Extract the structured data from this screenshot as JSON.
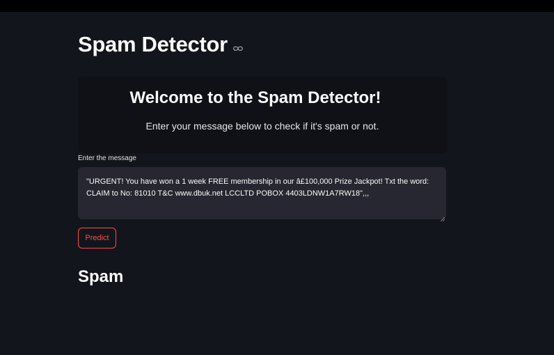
{
  "app": {
    "title": "Spam Detector",
    "link_icon": "link-icon"
  },
  "welcome": {
    "heading": "Welcome to the Spam Detector!",
    "subtitle": "Enter your message below to check if it's spam or not."
  },
  "input": {
    "label": "Enter the message",
    "value": "\"URGENT! You have won a 1 week FREE membership in our â£100,000 Prize Jackpot! Txt the word: CLAIM to No: 81010 T&C www.dbuk.net LCCLTD POBOX 4403LDNW1A7RW18\",,,"
  },
  "actions": {
    "predict_label": "Predict"
  },
  "result": {
    "label": "Spam"
  },
  "colors": {
    "background": "#13151c",
    "accent": "#ff4b4b",
    "input_bg": "#262730"
  }
}
